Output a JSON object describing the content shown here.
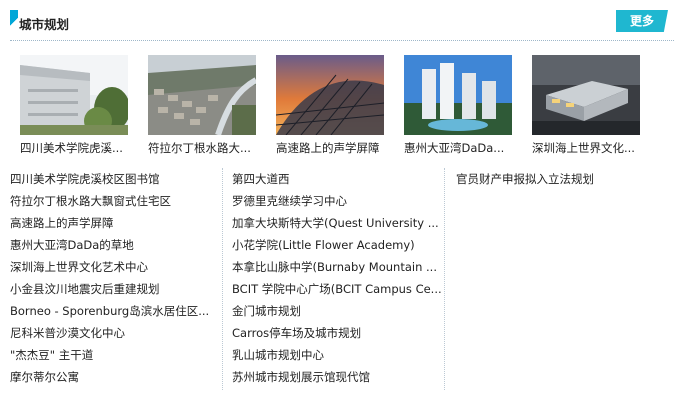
{
  "header": {
    "title": "城市规划",
    "more_label": "更多"
  },
  "thumbnails": [
    {
      "caption": "四川美术学院虎溪..."
    },
    {
      "caption": "符拉尔丁根水路大..."
    },
    {
      "caption": "高速路上的声学屏障"
    },
    {
      "caption": "惠州大亚湾DaDa..."
    },
    {
      "caption": "深圳海上世界文化..."
    }
  ],
  "columns": [
    {
      "items": [
        "四川美术学院虎溪校区图书馆",
        "符拉尔丁根水路大飘窗式住宅区",
        "高速路上的声学屏障",
        "惠州大亚湾DaDa的草地",
        "深圳海上世界文化艺术中心",
        "小金县汶川地震灾后重建规划",
        "Borneo - Sporenburg岛滨水居住区...",
        "尼科米普沙漠文化中心",
        "\"杰杰豆\" 主干道",
        "摩尔蒂尔公寓"
      ]
    },
    {
      "items": [
        "第四大道西",
        "罗德里克继续学习中心",
        "加拿大块斯特大学(Quest University ...",
        "小花学院(Little Flower Academy)",
        "本拿比山脉中学(Burnaby Mountain ...",
        "BCIT 学院中心广场(BCIT Campus Ce...",
        "金门城市规划",
        "Carros停车场及城市规划",
        "乳山城市规划中心",
        "苏州城市规划展示馆现代馆"
      ]
    },
    {
      "items": [
        "官员财产申报拟入立法规划"
      ]
    }
  ]
}
